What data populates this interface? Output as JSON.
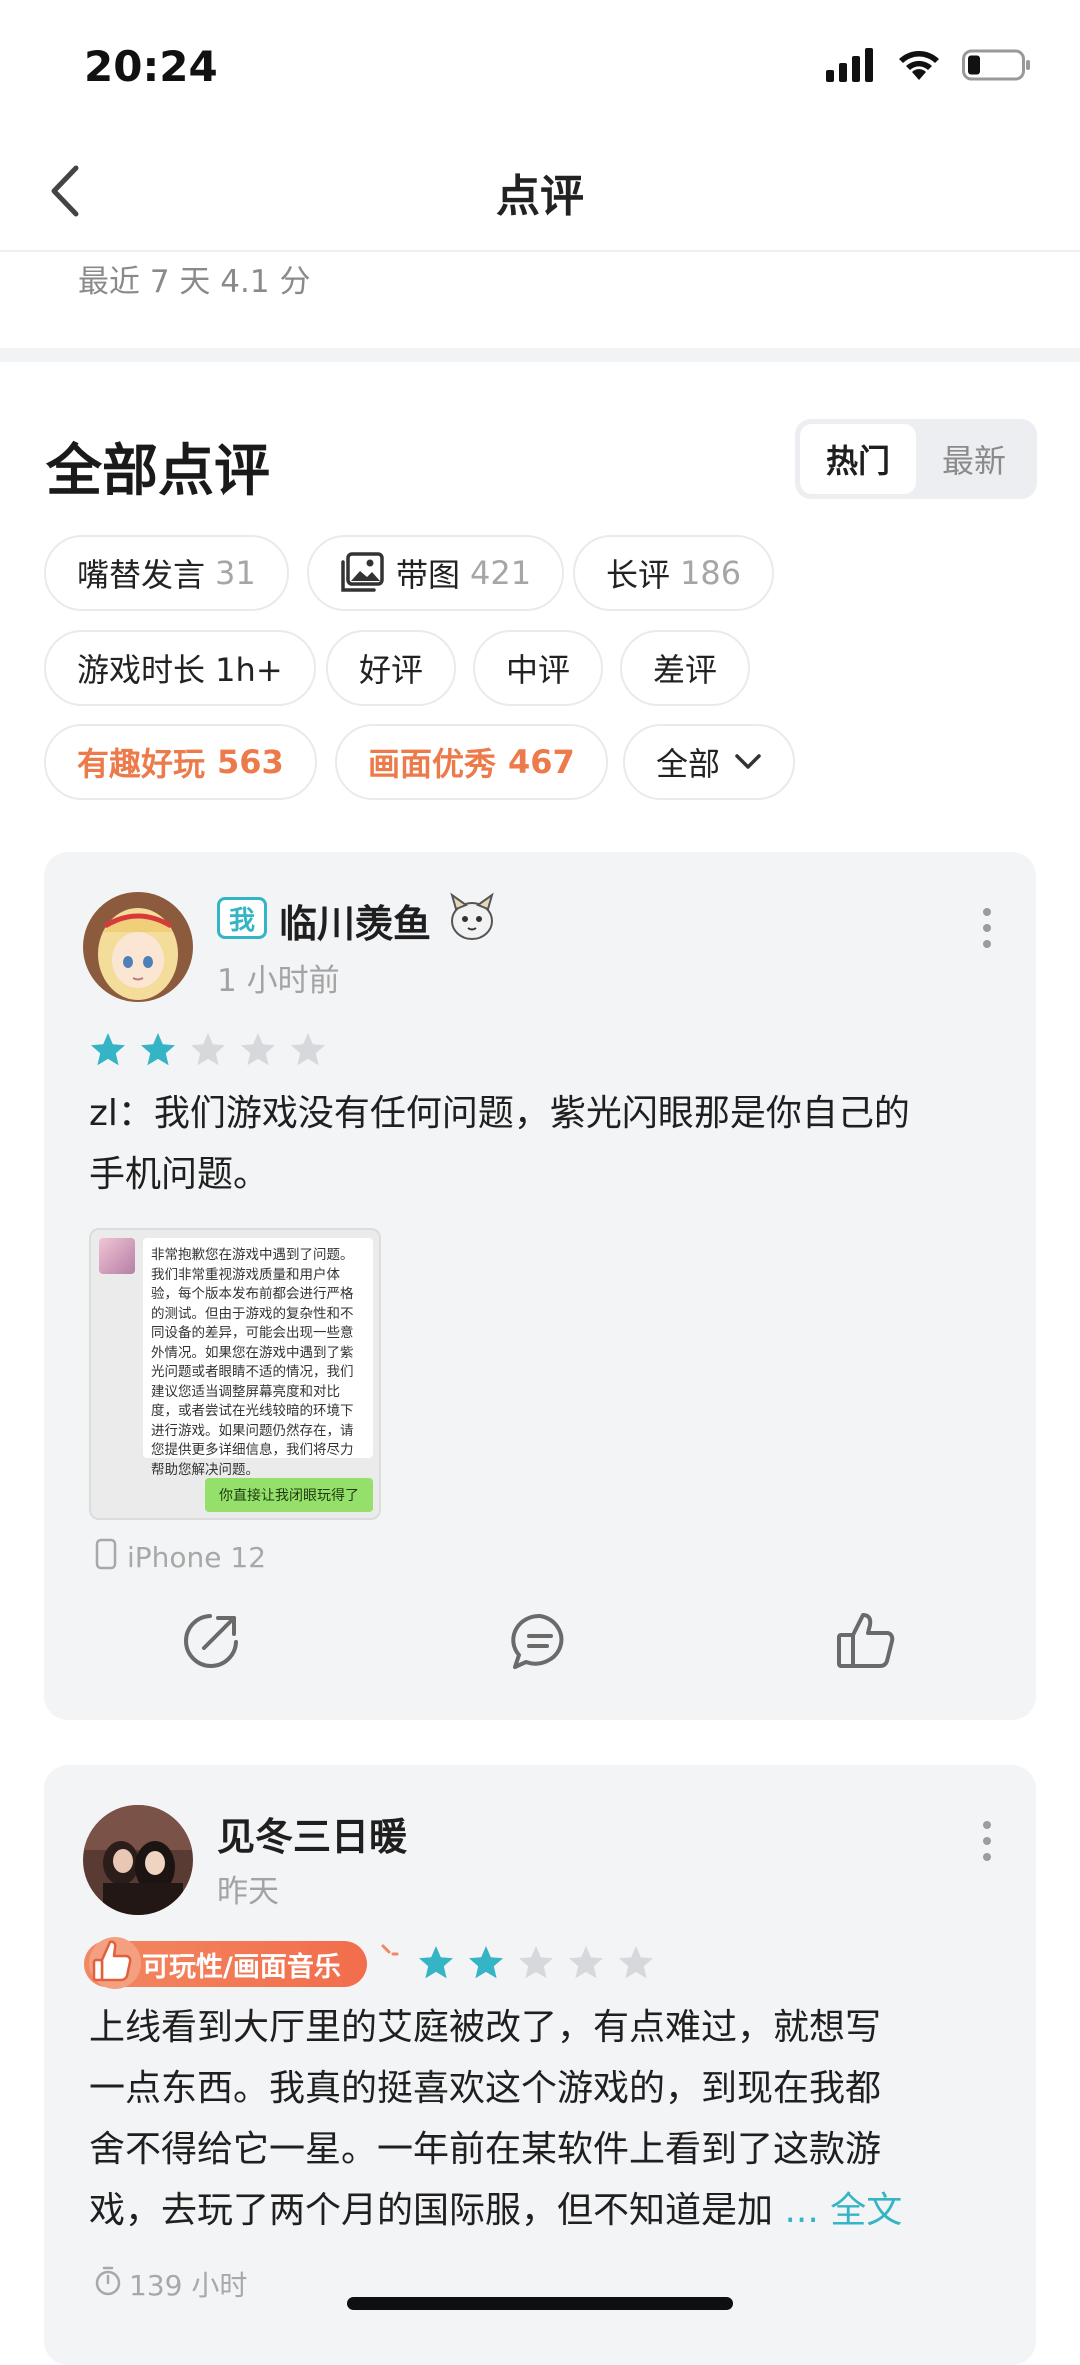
{
  "status_bar": {
    "time": "20:24"
  },
  "nav": {
    "title": "点评"
  },
  "summary": {
    "recent_rating": "最近 7 天 4.1 分"
  },
  "reviews_section": {
    "title": "全部点评",
    "sort": {
      "hot": "热门",
      "latest": "最新",
      "active": "hot"
    }
  },
  "filters": {
    "row1": [
      {
        "label": "嘴替发言",
        "count": "31"
      },
      {
        "label": "带图",
        "count": "421",
        "icon": "image-icon"
      },
      {
        "label": "长评",
        "count": "186"
      }
    ],
    "row2": [
      {
        "label": "游戏时长 1h+"
      },
      {
        "label": "好评"
      },
      {
        "label": "中评"
      },
      {
        "label": "差评"
      }
    ],
    "row3": [
      {
        "label": "有趣好玩",
        "count": "563",
        "highlight": true
      },
      {
        "label": "画面优秀",
        "count": "467",
        "highlight": true
      },
      {
        "label": "全部",
        "icon": "chevron-down-icon"
      }
    ]
  },
  "reviews": [
    {
      "me_badge": "我",
      "username": "临川羡鱼",
      "time": "1 小时前",
      "rating": 2,
      "max_rating": 5,
      "text_line1": "zl：我们游戏没有任何问题，紫光闪眼那是你自己的",
      "text_line2": "手机问题。",
      "image": {
        "text": "非常抱歉您在游戏中遇到了问题。我们非常重视游戏质量和用户体验，每个版本发布前都会进行严格的测试。但由于游戏的复杂性和不同设备的差异，可能会出现一些意外情况。如果您在游戏中遇到了紫光问题或者眼睛不适的情况，我们建议您适当调整屏幕亮度和对比度，或者尝试在光线较暗的环境下进行游戏。如果问题仍然存在，请您提供更多详细信息，我们将尽力帮助您解决问题。",
        "reply": "你直接让我闭眼玩得了"
      },
      "device": "iPhone 12"
    },
    {
      "username": "见冬三日暖",
      "time": "昨天",
      "tag": "可玩性/画面音乐",
      "rating": 2,
      "max_rating": 5,
      "text_line1": "上线看到大厅里的艾庭被改了，有点难过，就想写",
      "text_line2": "一点东西。我真的挺喜欢这个游戏的，到现在我都",
      "text_line3": "舍不得给它一星。一年前在某软件上看到了这款游",
      "text_line4": "戏，去玩了两个月的国际服，但不知道是加",
      "more_link": "... 全文",
      "playtime": "139 小时"
    }
  ],
  "colors": {
    "accent": "#34b4c4",
    "highlight": "#ed7a4a",
    "star_off": "#d6d8db",
    "card_bg": "#f3f4f6"
  }
}
